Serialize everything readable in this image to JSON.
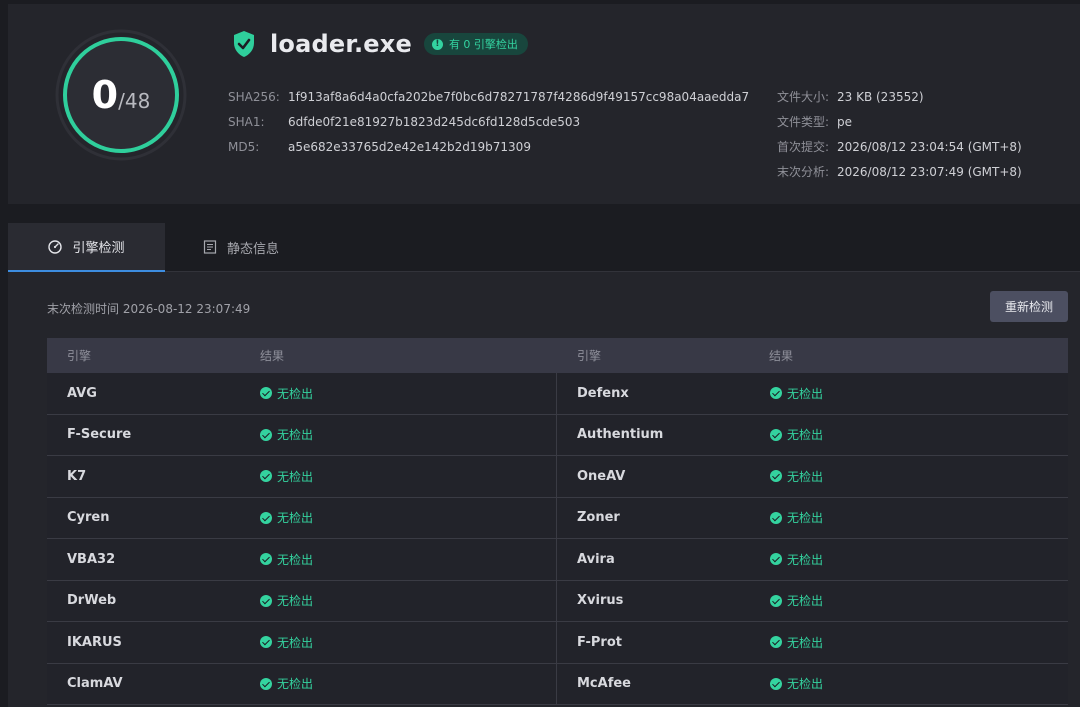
{
  "score": {
    "detected": "0",
    "total": "/48",
    "ring_color": "#2fcf9c"
  },
  "file": {
    "name": "loader.exe",
    "badge": "有 0 引擎检出",
    "badge_icon": "exclamation-icon",
    "shield_color": "#2fcf9c"
  },
  "hashes": [
    {
      "key": "SHA256:",
      "value": "1f913af8a6d4a0cfa202be7f0bc6d78271787f4286d9f49157cc98a04aaedda7"
    },
    {
      "key": "SHA1:",
      "value": "6dfde0f21e81927b1823d245dc6fd128d5cde503"
    },
    {
      "key": "MD5:",
      "value": "a5e682e33765d2e42e142b2d19b71309"
    }
  ],
  "meta": [
    {
      "key": "文件大小:",
      "value": "23 KB (23552)"
    },
    {
      "key": "文件类型:",
      "value": "pe"
    },
    {
      "key": "首次提交:",
      "value": "2026/08/12 23:04:54 (GMT+8)"
    },
    {
      "key": "末次分析:",
      "value": "2026/08/12 23:07:49 (GMT+8)"
    }
  ],
  "tabs": [
    {
      "label": "引擎检测",
      "icon": "gauge-icon",
      "active": true
    },
    {
      "label": "静态信息",
      "icon": "document-icon",
      "active": false
    }
  ],
  "scan": {
    "last_scan": "末次检测时间 2026-08-12 23:07:49",
    "rescan_label": "重新检测"
  },
  "table": {
    "headers": {
      "engine": "引擎",
      "result": "结果"
    },
    "rows": [
      {
        "left": {
          "engine": "AVG",
          "result": "无检出"
        },
        "right": {
          "engine": "Defenx",
          "result": "无检出"
        }
      },
      {
        "left": {
          "engine": "F-Secure",
          "result": "无检出"
        },
        "right": {
          "engine": "Authentium",
          "result": "无检出"
        }
      },
      {
        "left": {
          "engine": "K7",
          "result": "无检出"
        },
        "right": {
          "engine": "OneAV",
          "result": "无检出"
        }
      },
      {
        "left": {
          "engine": "Cyren",
          "result": "无检出"
        },
        "right": {
          "engine": "Zoner",
          "result": "无检出"
        }
      },
      {
        "left": {
          "engine": "VBA32",
          "result": "无检出"
        },
        "right": {
          "engine": "Avira",
          "result": "无检出"
        }
      },
      {
        "left": {
          "engine": "DrWeb",
          "result": "无检出"
        },
        "right": {
          "engine": "Xvirus",
          "result": "无检出"
        }
      },
      {
        "left": {
          "engine": "IKARUS",
          "result": "无检出"
        },
        "right": {
          "engine": "F-Prot",
          "result": "无检出"
        }
      },
      {
        "left": {
          "engine": "ClamAV",
          "result": "无检出"
        },
        "right": {
          "engine": "McAfee",
          "result": "无检出"
        }
      }
    ]
  }
}
